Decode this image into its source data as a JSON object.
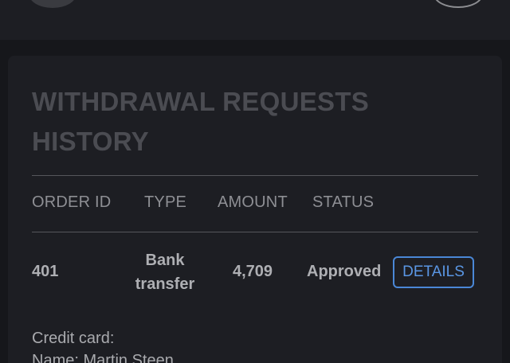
{
  "card": {
    "title": "WITHDRAWAL REQUESTS HISTORY"
  },
  "table": {
    "headers": [
      "ORDER ID",
      "TYPE",
      "AMOUNT",
      "STATUS"
    ],
    "rows": [
      {
        "order_id": "401",
        "type_line1": "Bank",
        "type_line2": "transfer",
        "amount": "4,709",
        "status": "Approved",
        "action": "DETAILS"
      }
    ]
  },
  "details": {
    "line1": "Credit card:",
    "line2": "Name: Martin Steen"
  }
}
